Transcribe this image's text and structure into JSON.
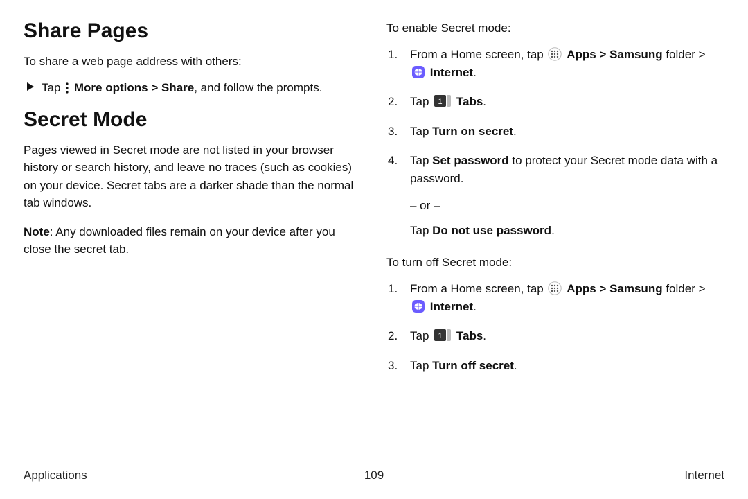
{
  "left": {
    "h_share": "Share Pages",
    "share_intro": "To share a web page address with others:",
    "share_step_pre": "Tap ",
    "share_step_more": "More options",
    "share_step_sep": " > ",
    "share_step_share": "Share",
    "share_step_post": ", and follow the prompts.",
    "h_secret": "Secret Mode",
    "secret_para": "Pages viewed in Secret mode are not listed in your browser history or search history, and leave no traces (such as cookies) on your device. Secret tabs are a darker shade than the normal tab windows.",
    "note_label": "Note",
    "note_body": ": Any downloaded files remain on your device after you close the secret tab."
  },
  "right": {
    "enable_intro": "To enable Secret mode:",
    "step1_pre": "From a Home screen, tap ",
    "apps": "Apps",
    "sep": " > ",
    "samsung": "Samsung",
    "folder_word": " folder > ",
    "internet": "Internet",
    "period": ".",
    "step2_pre": "Tap ",
    "tabs": "Tabs",
    "step3_pre": "Tap ",
    "turn_on": "Turn on secret",
    "step4_pre": "Tap ",
    "set_pw": "Set password",
    "step4_post": " to protect your Secret mode data with a password.",
    "or_line": "– or –",
    "donot_pre": "Tap ",
    "donot": "Do not use password",
    "turnoff_intro": "To turn off Secret mode:",
    "turn_off": "Turn off secret"
  },
  "footer": {
    "left": "Applications",
    "center": "109",
    "right": "Internet"
  }
}
